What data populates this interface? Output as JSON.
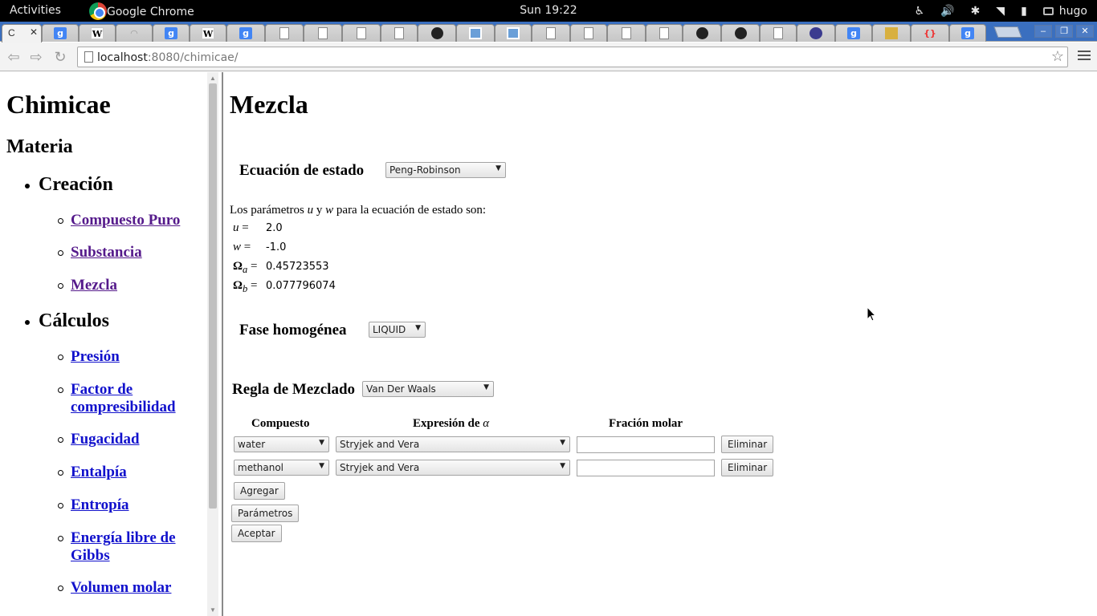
{
  "gnome": {
    "activities": "Activities",
    "app_name": "Google Chrome",
    "clock": "Sun 19:22",
    "user": "hugo"
  },
  "browser": {
    "active_tab_title": "C",
    "url_host": "localhost",
    "url_rest": ":8080/chimicae/"
  },
  "sidebar": {
    "title": "Chimicae",
    "subtitle": "Materia",
    "sections": [
      {
        "title": "Creación",
        "items": [
          "Compuesto Puro",
          "Substancia",
          "Mezcla"
        ]
      },
      {
        "title": "Cálculos",
        "items": [
          "Presión",
          "Factor de compresibilidad",
          "Fugacidad",
          "Entalpía",
          "Entropía",
          "Energía libre de Gibbs",
          "Volumen molar"
        ]
      }
    ]
  },
  "main": {
    "title": "Mezcla",
    "eos_label": "Ecuación de estado",
    "eos_selected": "Peng-Robinson",
    "params_intro_pre": "Los parámetros ",
    "params_intro_u": "u",
    "params_intro_y": " y ",
    "params_intro_w": "w",
    "params_intro_post": " para la ecuación de estado son:",
    "params": [
      {
        "name": "u",
        "value": "2.0"
      },
      {
        "name": "w",
        "value": "-1.0"
      },
      {
        "name": "Ω",
        "sub": "a",
        "value": "0.45723553"
      },
      {
        "name": "Ω",
        "sub": "b",
        "value": "0.077796074"
      }
    ],
    "phase_label": "Fase homogénea",
    "phase_selected": "LIQUID",
    "mix_rule_label": "Regla de Mezclado",
    "mix_rule_selected": "Van Der Waals",
    "table_headers": {
      "compound": "Compuesto",
      "alpha_pre": "Expresión de ",
      "alpha_sym": "α",
      "fraction": "Fración molar"
    },
    "rows": [
      {
        "compound": "water",
        "alpha": "Stryjek and Vera",
        "fraction": "",
        "remove": "Eliminar"
      },
      {
        "compound": "methanol",
        "alpha": "Stryjek and Vera",
        "fraction": "",
        "remove": "Eliminar"
      }
    ],
    "add_label": "Agregar",
    "params_label": "Parámetros",
    "accept_label": "Aceptar"
  }
}
